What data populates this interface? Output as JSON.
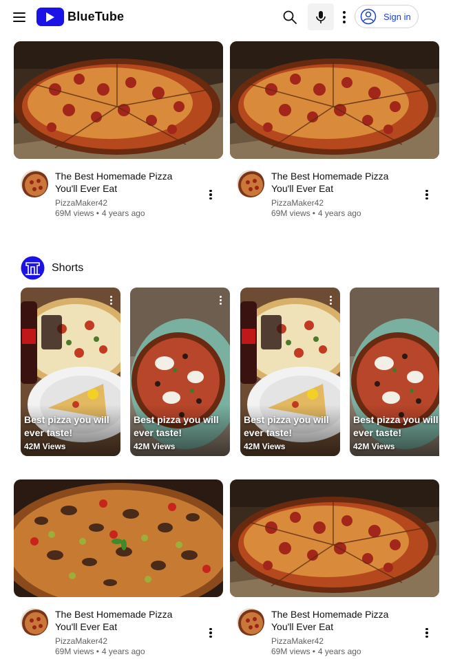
{
  "header": {
    "brand": "BlueTube",
    "menu_icon": "hamburger-menu-icon",
    "search_icon": "search-icon",
    "mic_icon": "microphone-icon",
    "more_icon": "more-vertical-icon",
    "signin_label": "Sign in",
    "signin_icon": "account-circle-icon",
    "brand_color": "#1a12e6"
  },
  "videos_top": [
    {
      "title": "The Best Homemade Pizza You'll Ever Eat",
      "channel": "PizzaMaker42",
      "views": "69M views",
      "age": "4 years ago",
      "thumbnail": "sliced-pepperoni-pizza"
    },
    {
      "title": "The Best Homemade Pizza You'll Ever Eat",
      "channel": "PizzaMaker42",
      "views": "69M views",
      "age": "4 years ago",
      "thumbnail": "sliced-pepperoni-pizza"
    }
  ],
  "shorts": {
    "title": "Shorts",
    "icon": "shorts-logo-icon",
    "items": [
      {
        "title": "Best pizza you will ever taste!",
        "views": "42M Views",
        "thumbnail": "pizza-with-cola"
      },
      {
        "title": "Best pizza you will ever taste!",
        "views": "42M Views",
        "thumbnail": "pizza-on-green-table"
      },
      {
        "title": "Best pizza you will ever taste!",
        "views": "42M Views",
        "thumbnail": "pizza-with-cola"
      },
      {
        "title": "Best pizza you will ever taste!",
        "views": "42M Views",
        "thumbnail": "pizza-on-green-table"
      }
    ]
  },
  "videos_bottom": [
    {
      "title": "The Best Homemade Pizza You'll Ever Eat",
      "channel": "PizzaMaker42",
      "views": "69M views",
      "age": "4 years ago",
      "thumbnail": "mushroom-olive-pizza"
    },
    {
      "title": "The Best Homemade Pizza You'll Ever Eat",
      "channel": "PizzaMaker42",
      "views": "69M views",
      "age": "4 years ago",
      "thumbnail": "sliced-pepperoni-pizza"
    }
  ]
}
